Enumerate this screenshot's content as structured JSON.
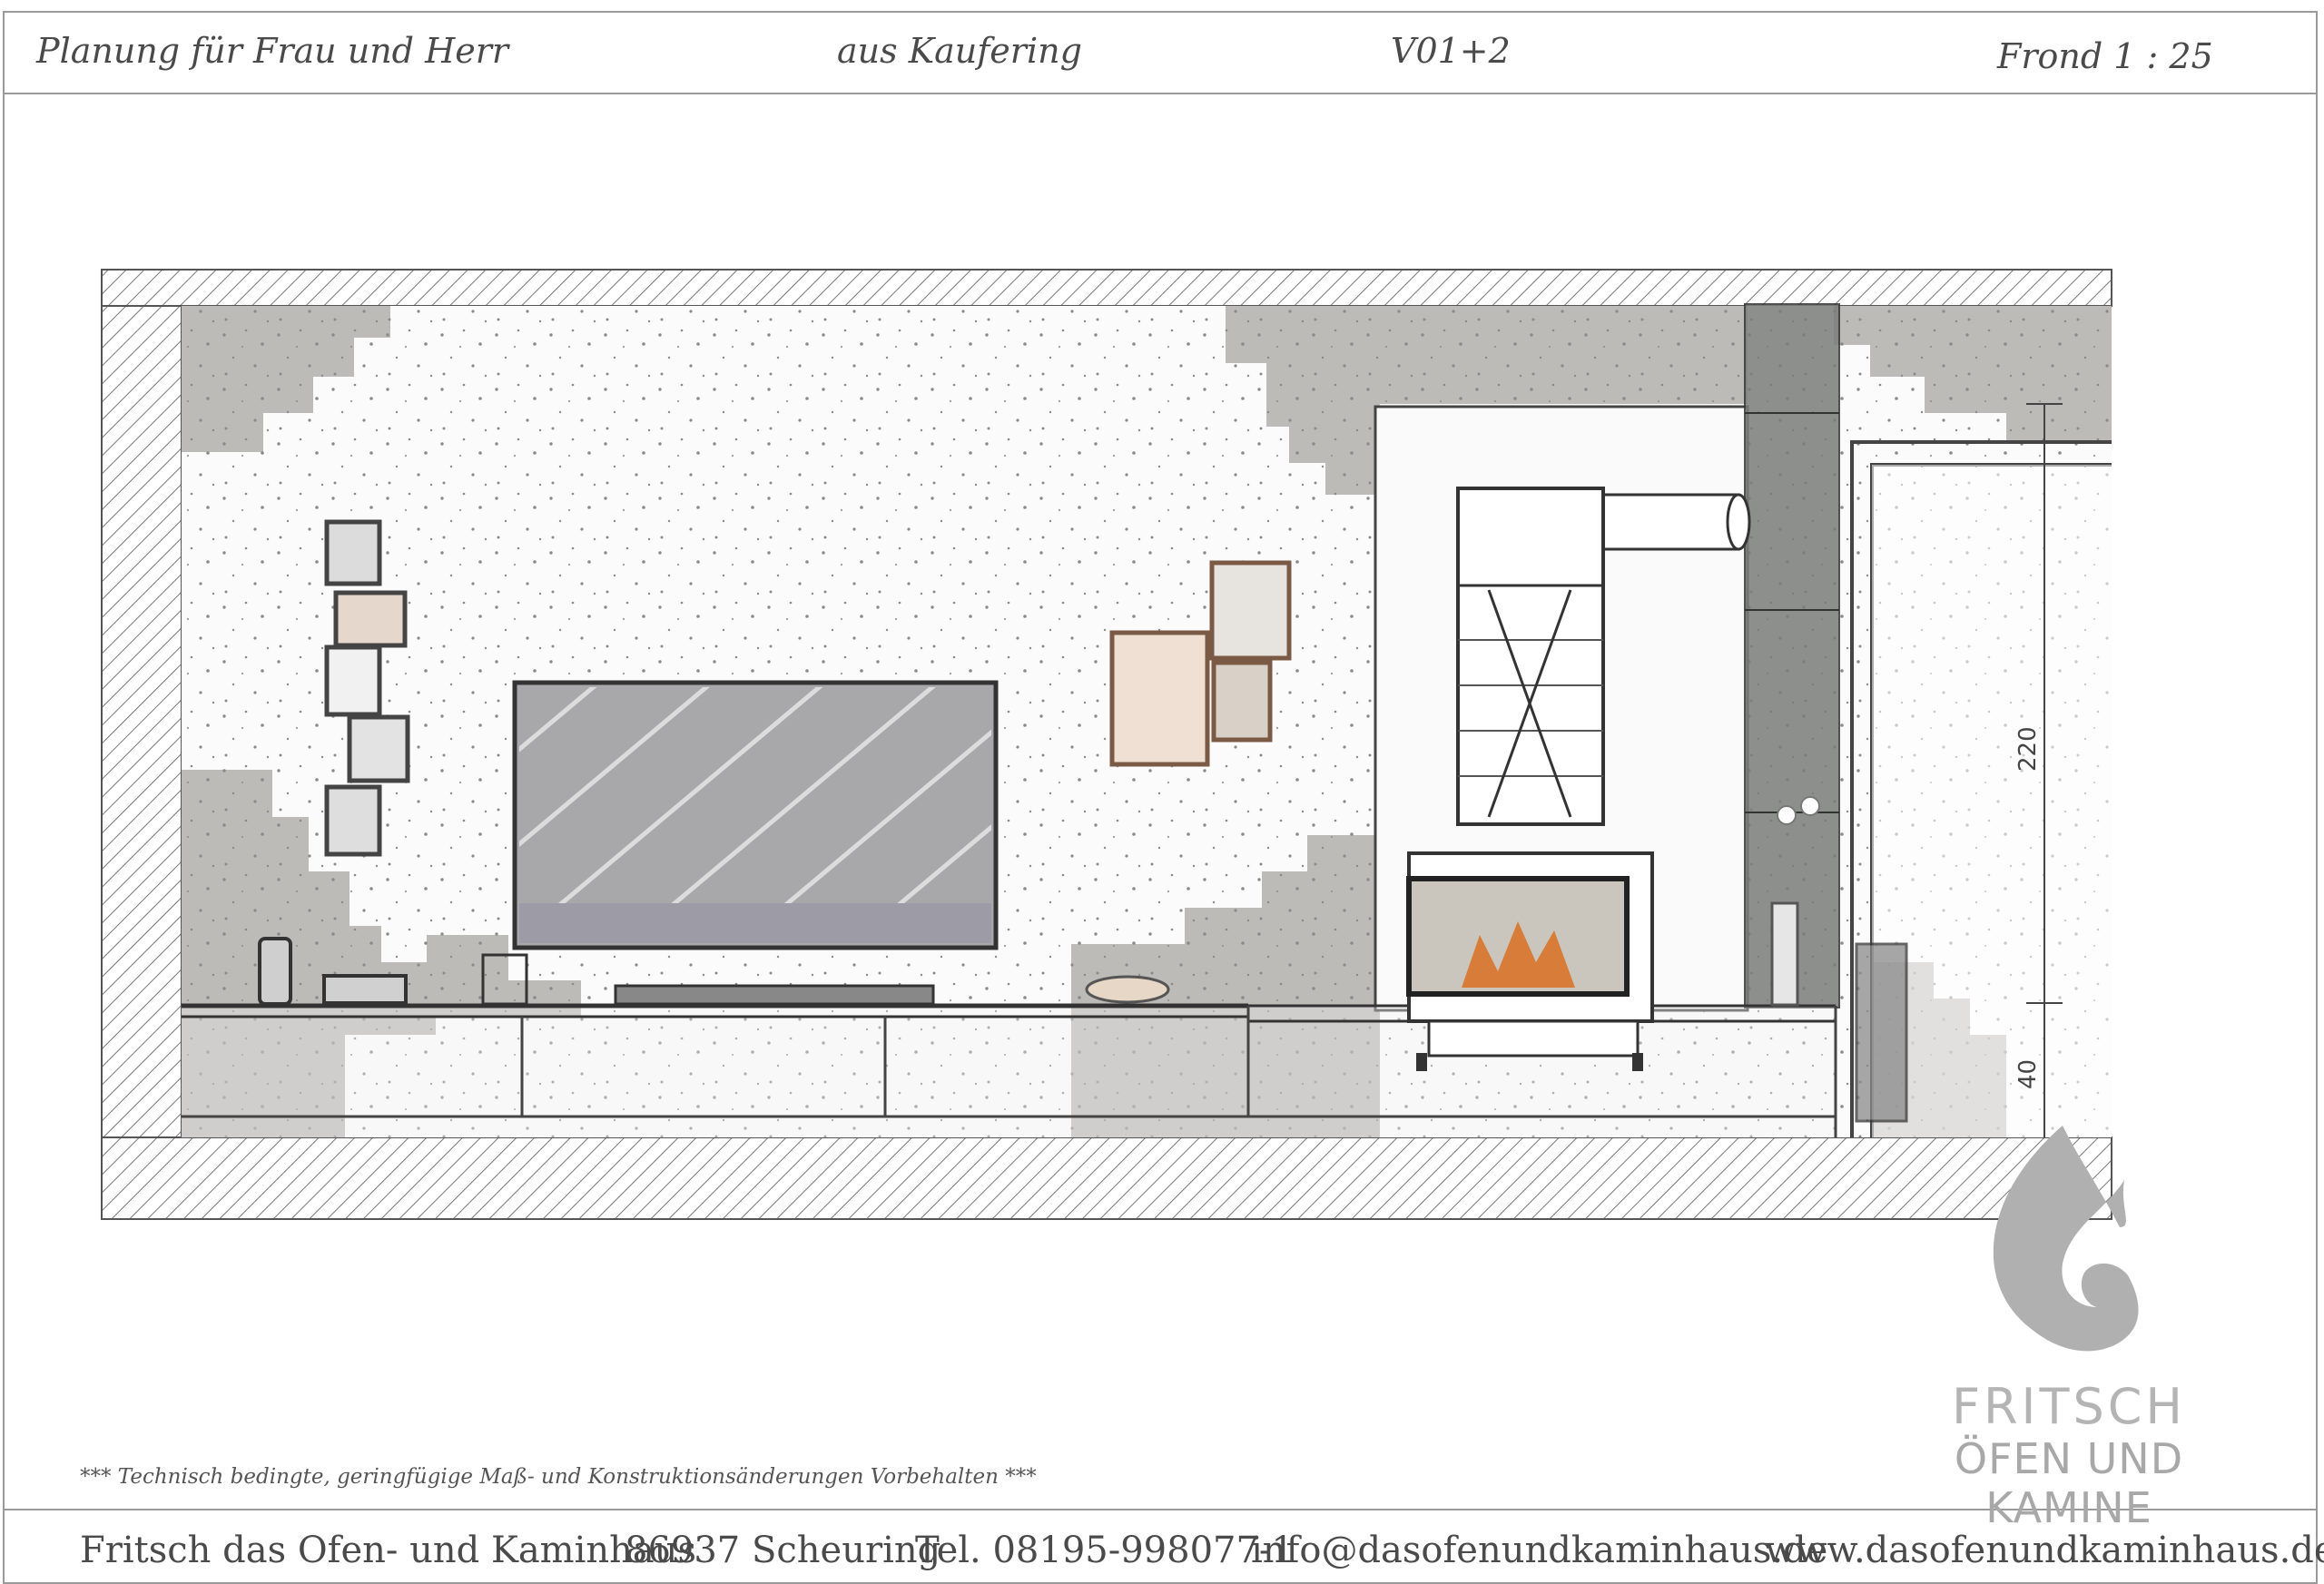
{
  "header": {
    "planning": "Planung für Frau und Herr",
    "location": "aus Kaufering",
    "version": "V01+2",
    "view_scale": "Frond  1 : 25"
  },
  "drawing": {
    "dimension_height": "220",
    "dimension_base": "40"
  },
  "note": "***   Technisch bedingte, geringfügige Maß- und Konstruktionsänderungen Vorbehalten   ***",
  "logo": {
    "line1": "FRITSCH",
    "line2": "ÖFEN UND KAMINE",
    "color": "#b0b0b0"
  },
  "footer": {
    "company": "Fritsch das Ofen- und Kaminhaus",
    "city": "86937 Scheuring",
    "phone": "Tel. 08195-998077-1",
    "email": "info@dasofenundkaminhaus.de",
    "website": "www.dasofenundkaminhaus.de"
  },
  "colors": {
    "concrete": "#b9b7b3",
    "wall_white": "#fbfbfb",
    "tv_screen": "#a8a8ab",
    "frame_wood": "#d9a07a",
    "fire": "#d9742a",
    "chimney_column": "#7a7d7a"
  }
}
